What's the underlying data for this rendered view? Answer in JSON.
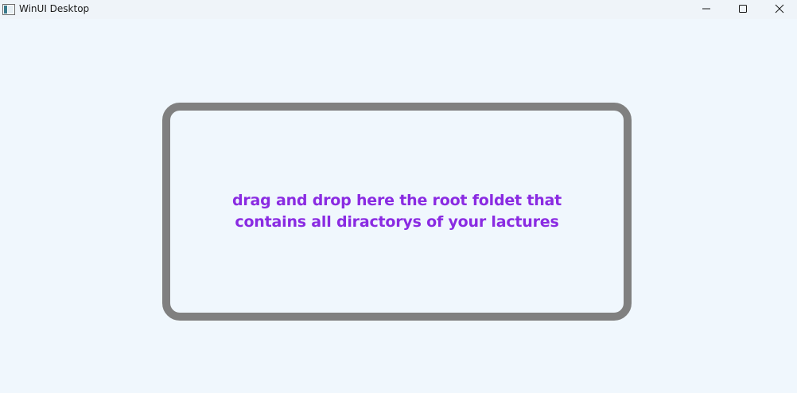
{
  "window": {
    "title": "WinUI Desktop",
    "icon": "app-window-icon",
    "caption_buttons": {
      "minimize_icon": "minimize-icon",
      "maximize_icon": "maximize-icon",
      "close_icon": "close-icon"
    }
  },
  "drop_zone": {
    "message": "drag and drop here the root foldet that contains all diractorys of your lactures",
    "text_color": "#8a2be2",
    "border_color": "#808080"
  }
}
